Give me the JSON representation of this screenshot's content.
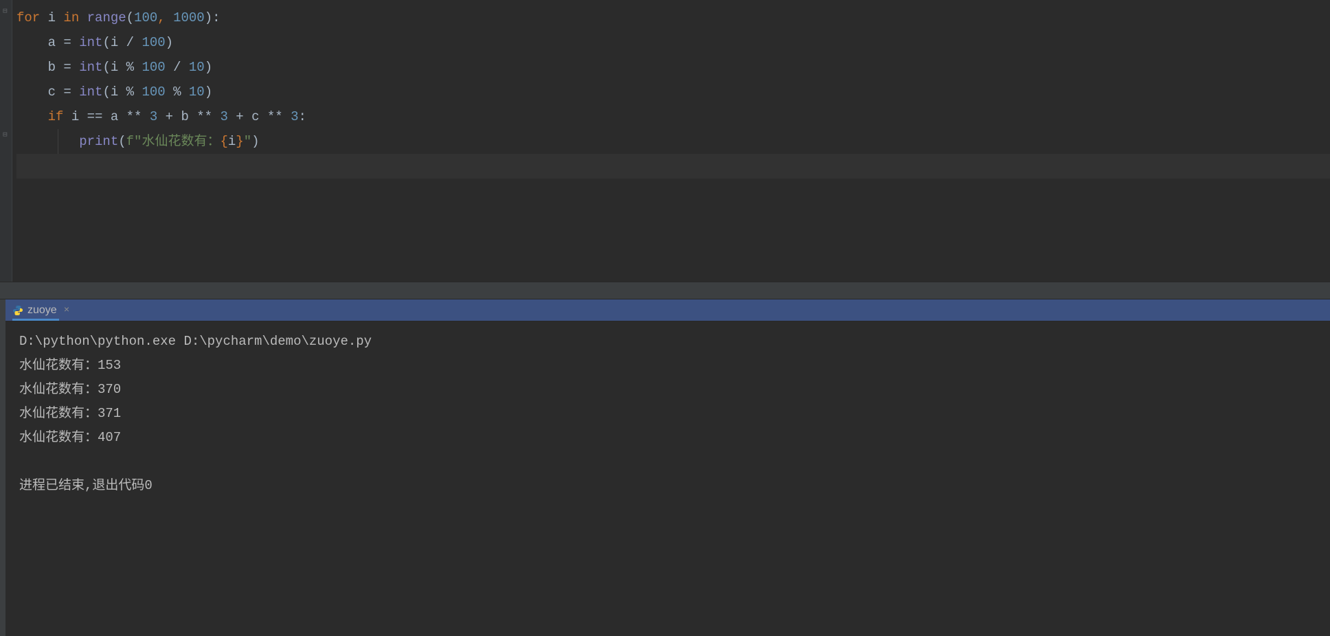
{
  "editor": {
    "lines": [
      {
        "indent": 0,
        "tokens": [
          {
            "type": "kw",
            "text": "for "
          },
          {
            "type": "ident",
            "text": "i "
          },
          {
            "type": "kw",
            "text": "in "
          },
          {
            "type": "builtin",
            "text": "range"
          },
          {
            "type": "op",
            "text": "("
          },
          {
            "type": "num",
            "text": "100"
          },
          {
            "type": "comma",
            "text": ", "
          },
          {
            "type": "num",
            "text": "1000"
          },
          {
            "type": "op",
            "text": "):"
          }
        ]
      },
      {
        "indent": 1,
        "tokens": [
          {
            "type": "ident",
            "text": "a = "
          },
          {
            "type": "builtin",
            "text": "int"
          },
          {
            "type": "op",
            "text": "(i / "
          },
          {
            "type": "num",
            "text": "100"
          },
          {
            "type": "op",
            "text": ")"
          }
        ]
      },
      {
        "indent": 1,
        "tokens": [
          {
            "type": "ident",
            "text": "b = "
          },
          {
            "type": "builtin",
            "text": "int"
          },
          {
            "type": "op",
            "text": "(i % "
          },
          {
            "type": "num",
            "text": "100"
          },
          {
            "type": "op",
            "text": " / "
          },
          {
            "type": "num",
            "text": "10"
          },
          {
            "type": "op",
            "text": ")"
          }
        ]
      },
      {
        "indent": 1,
        "tokens": [
          {
            "type": "ident",
            "text": "c = "
          },
          {
            "type": "builtin",
            "text": "int"
          },
          {
            "type": "op",
            "text": "(i % "
          },
          {
            "type": "num",
            "text": "100"
          },
          {
            "type": "op",
            "text": " % "
          },
          {
            "type": "num",
            "text": "10"
          },
          {
            "type": "op",
            "text": ")"
          }
        ]
      },
      {
        "indent": 1,
        "tokens": [
          {
            "type": "kw",
            "text": "if "
          },
          {
            "type": "ident",
            "text": "i == a ** "
          },
          {
            "type": "num",
            "text": "3"
          },
          {
            "type": "ident",
            "text": " + b ** "
          },
          {
            "type": "num",
            "text": "3"
          },
          {
            "type": "ident",
            "text": " + c ** "
          },
          {
            "type": "num",
            "text": "3"
          },
          {
            "type": "op",
            "text": ":"
          }
        ]
      },
      {
        "indent": 2,
        "tokens": [
          {
            "type": "builtin",
            "text": "print"
          },
          {
            "type": "op",
            "text": "("
          },
          {
            "type": "fstring-prefix",
            "text": "f\""
          },
          {
            "type": "fstring-text",
            "text": "水仙花数有："
          },
          {
            "type": "fstring-brace",
            "text": "{"
          },
          {
            "type": "ident",
            "text": "i"
          },
          {
            "type": "fstring-brace",
            "text": "}"
          },
          {
            "type": "fstring-prefix",
            "text": "\""
          },
          {
            "type": "op",
            "text": ")"
          }
        ]
      },
      {
        "indent": 0,
        "tokens": [],
        "active": true
      }
    ]
  },
  "tab": {
    "label": "zuoye",
    "close": "×"
  },
  "console": {
    "lines": [
      "D:\\python\\python.exe D:\\pycharm\\demo\\zuoye.py",
      "水仙花数有：153",
      "水仙花数有：370",
      "水仙花数有：371",
      "水仙花数有：407",
      "",
      "进程已结束,退出代码0"
    ]
  }
}
